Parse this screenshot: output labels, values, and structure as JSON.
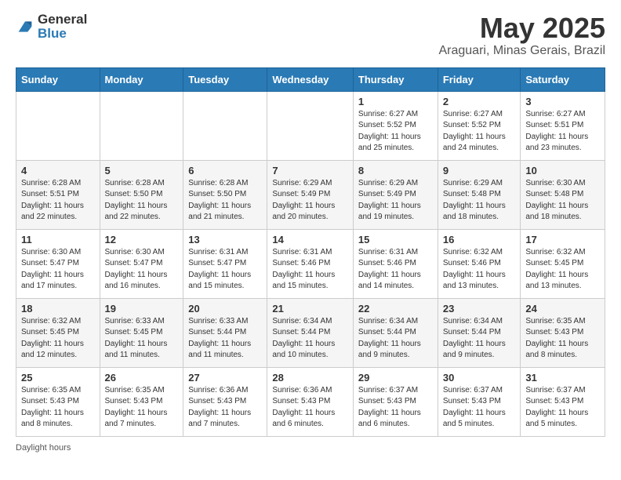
{
  "header": {
    "logo_general": "General",
    "logo_blue": "Blue",
    "month_title": "May 2025",
    "location": "Araguari, Minas Gerais, Brazil"
  },
  "calendar": {
    "weekdays": [
      "Sunday",
      "Monday",
      "Tuesday",
      "Wednesday",
      "Thursday",
      "Friday",
      "Saturday"
    ],
    "weeks": [
      [
        {
          "day": "",
          "info": ""
        },
        {
          "day": "",
          "info": ""
        },
        {
          "day": "",
          "info": ""
        },
        {
          "day": "",
          "info": ""
        },
        {
          "day": "1",
          "info": "Sunrise: 6:27 AM\nSunset: 5:52 PM\nDaylight: 11 hours and 25 minutes."
        },
        {
          "day": "2",
          "info": "Sunrise: 6:27 AM\nSunset: 5:52 PM\nDaylight: 11 hours and 24 minutes."
        },
        {
          "day": "3",
          "info": "Sunrise: 6:27 AM\nSunset: 5:51 PM\nDaylight: 11 hours and 23 minutes."
        }
      ],
      [
        {
          "day": "4",
          "info": "Sunrise: 6:28 AM\nSunset: 5:51 PM\nDaylight: 11 hours and 22 minutes."
        },
        {
          "day": "5",
          "info": "Sunrise: 6:28 AM\nSunset: 5:50 PM\nDaylight: 11 hours and 22 minutes."
        },
        {
          "day": "6",
          "info": "Sunrise: 6:28 AM\nSunset: 5:50 PM\nDaylight: 11 hours and 21 minutes."
        },
        {
          "day": "7",
          "info": "Sunrise: 6:29 AM\nSunset: 5:49 PM\nDaylight: 11 hours and 20 minutes."
        },
        {
          "day": "8",
          "info": "Sunrise: 6:29 AM\nSunset: 5:49 PM\nDaylight: 11 hours and 19 minutes."
        },
        {
          "day": "9",
          "info": "Sunrise: 6:29 AM\nSunset: 5:48 PM\nDaylight: 11 hours and 18 minutes."
        },
        {
          "day": "10",
          "info": "Sunrise: 6:30 AM\nSunset: 5:48 PM\nDaylight: 11 hours and 18 minutes."
        }
      ],
      [
        {
          "day": "11",
          "info": "Sunrise: 6:30 AM\nSunset: 5:47 PM\nDaylight: 11 hours and 17 minutes."
        },
        {
          "day": "12",
          "info": "Sunrise: 6:30 AM\nSunset: 5:47 PM\nDaylight: 11 hours and 16 minutes."
        },
        {
          "day": "13",
          "info": "Sunrise: 6:31 AM\nSunset: 5:47 PM\nDaylight: 11 hours and 15 minutes."
        },
        {
          "day": "14",
          "info": "Sunrise: 6:31 AM\nSunset: 5:46 PM\nDaylight: 11 hours and 15 minutes."
        },
        {
          "day": "15",
          "info": "Sunrise: 6:31 AM\nSunset: 5:46 PM\nDaylight: 11 hours and 14 minutes."
        },
        {
          "day": "16",
          "info": "Sunrise: 6:32 AM\nSunset: 5:46 PM\nDaylight: 11 hours and 13 minutes."
        },
        {
          "day": "17",
          "info": "Sunrise: 6:32 AM\nSunset: 5:45 PM\nDaylight: 11 hours and 13 minutes."
        }
      ],
      [
        {
          "day": "18",
          "info": "Sunrise: 6:32 AM\nSunset: 5:45 PM\nDaylight: 11 hours and 12 minutes."
        },
        {
          "day": "19",
          "info": "Sunrise: 6:33 AM\nSunset: 5:45 PM\nDaylight: 11 hours and 11 minutes."
        },
        {
          "day": "20",
          "info": "Sunrise: 6:33 AM\nSunset: 5:44 PM\nDaylight: 11 hours and 11 minutes."
        },
        {
          "day": "21",
          "info": "Sunrise: 6:34 AM\nSunset: 5:44 PM\nDaylight: 11 hours and 10 minutes."
        },
        {
          "day": "22",
          "info": "Sunrise: 6:34 AM\nSunset: 5:44 PM\nDaylight: 11 hours and 9 minutes."
        },
        {
          "day": "23",
          "info": "Sunrise: 6:34 AM\nSunset: 5:44 PM\nDaylight: 11 hours and 9 minutes."
        },
        {
          "day": "24",
          "info": "Sunrise: 6:35 AM\nSunset: 5:43 PM\nDaylight: 11 hours and 8 minutes."
        }
      ],
      [
        {
          "day": "25",
          "info": "Sunrise: 6:35 AM\nSunset: 5:43 PM\nDaylight: 11 hours and 8 minutes."
        },
        {
          "day": "26",
          "info": "Sunrise: 6:35 AM\nSunset: 5:43 PM\nDaylight: 11 hours and 7 minutes."
        },
        {
          "day": "27",
          "info": "Sunrise: 6:36 AM\nSunset: 5:43 PM\nDaylight: 11 hours and 7 minutes."
        },
        {
          "day": "28",
          "info": "Sunrise: 6:36 AM\nSunset: 5:43 PM\nDaylight: 11 hours and 6 minutes."
        },
        {
          "day": "29",
          "info": "Sunrise: 6:37 AM\nSunset: 5:43 PM\nDaylight: 11 hours and 6 minutes."
        },
        {
          "day": "30",
          "info": "Sunrise: 6:37 AM\nSunset: 5:43 PM\nDaylight: 11 hours and 5 minutes."
        },
        {
          "day": "31",
          "info": "Sunrise: 6:37 AM\nSunset: 5:43 PM\nDaylight: 11 hours and 5 minutes."
        }
      ]
    ]
  },
  "footer": {
    "note": "Daylight hours"
  }
}
